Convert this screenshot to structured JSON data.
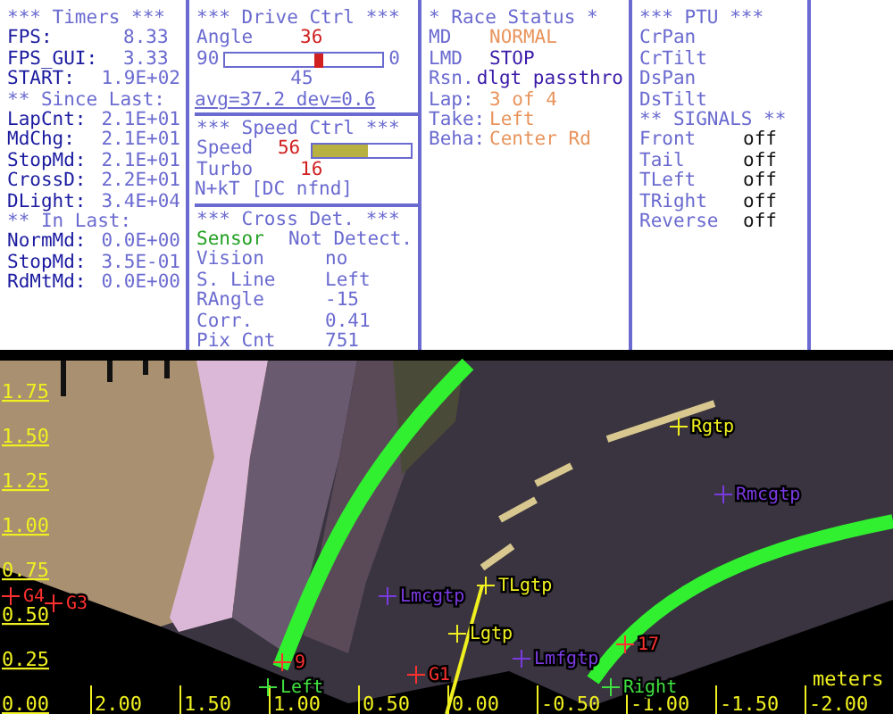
{
  "timers": {
    "title": "*** Timers ***",
    "rows": [
      {
        "kind": "row",
        "label": "FPS:",
        "value": "8.33"
      },
      {
        "kind": "row",
        "label": "FPS_GUI:",
        "value": "3.33"
      },
      {
        "kind": "row",
        "label": "START:",
        "value": "1.9E+02"
      },
      {
        "kind": "heading",
        "label": "** Since Last:"
      },
      {
        "kind": "row",
        "label": "LapCnt:",
        "value": "2.1E+01"
      },
      {
        "kind": "row",
        "label": "MdChg:",
        "value": "2.1E+01"
      },
      {
        "kind": "row",
        "label": "StopMd:",
        "value": "2.1E+01"
      },
      {
        "kind": "row",
        "label": "CrossD:",
        "value": "2.2E+01"
      },
      {
        "kind": "row",
        "label": "DLight:",
        "value": "3.4E+04"
      },
      {
        "kind": "heading",
        "label": "** In Last:"
      },
      {
        "kind": "row",
        "label": "NormMd:",
        "value": "0.0E+00"
      },
      {
        "kind": "row",
        "label": "StopMd:",
        "value": "3.5E-01"
      },
      {
        "kind": "row",
        "label": "RdMtMd:",
        "value": "0.0E+00"
      }
    ]
  },
  "drive_ctrl": {
    "title": "***  Drive Ctrl  ***",
    "angle_label": "Angle",
    "angle_value": "36",
    "slider": {
      "left_label": "90",
      "right_label": "0",
      "mid_label": "45",
      "level": 0.6
    },
    "stats": "avg=37.2  dev=0.6"
  },
  "speed_ctrl": {
    "title": "***  Speed Ctrl  ***",
    "speed_label": "Speed",
    "speed_value": "56",
    "speed_bar": {
      "level": 0.57
    },
    "turbo_label": "Turbo",
    "turbo_value": "16",
    "note": "N+kT [DC nfnd]"
  },
  "cross_det": {
    "title": "*** Cross Det. ***",
    "rows": [
      {
        "label": "Sensor",
        "value": "Not Detect.",
        "color": "#22a022"
      },
      {
        "label": "Vision",
        "value": "no",
        "color": "#6a6ad0"
      },
      {
        "label": "S. Line",
        "value": "Left",
        "color": "#6a6ad0"
      },
      {
        "label": "RAngle",
        "value": "-15",
        "color": "#6a6ad0"
      },
      {
        "label": "Corr.",
        "value": "0.41",
        "color": "#6a6ad0"
      },
      {
        "label": "Pix Cnt",
        "value": "751",
        "color": "#6a6ad0"
      }
    ]
  },
  "race_status": {
    "title": "* Race Status *",
    "rows": [
      {
        "label": "MD",
        "value": "NORMAL",
        "color": "#e8945c"
      },
      {
        "label": "LMD",
        "value": "STOP",
        "color": "#3a1aa8"
      },
      {
        "label": "Rsn.",
        "value": "dlgt passthro",
        "color": "#3a1aa8"
      },
      {
        "label": "Lap:",
        "value": "3 of 4",
        "color": "#e8945c"
      },
      {
        "label": "Take:",
        "value": "Left",
        "color": "#e8945c"
      },
      {
        "label": "Beha:",
        "value": "Center Rd",
        "color": "#e8945c"
      }
    ]
  },
  "ptu": {
    "title": "*** PTU ***",
    "items": [
      "CrPan",
      "CrTilt",
      "DsPan",
      "DsTilt"
    ],
    "signals_title": "** SIGNALS **",
    "signals": [
      {
        "label": "Front",
        "value": "off"
      },
      {
        "label": "Tail",
        "value": "off"
      },
      {
        "label": "TLeft",
        "value": "off"
      },
      {
        "label": "TRight",
        "value": "off"
      },
      {
        "label": "Reverse",
        "value": "off"
      }
    ]
  },
  "camera": {
    "y_labels": [
      "1.75",
      "1.50",
      "1.25",
      "1.00",
      "0.75",
      "0.50",
      "0.25",
      "0.00"
    ],
    "x_labels": [
      "2.00",
      "1.50",
      "1.00",
      "0.50",
      "0.00",
      "-0.50",
      "-1.00",
      "-1.50",
      "-2.00"
    ],
    "unit": "meters",
    "markers": [
      {
        "label": "G4",
        "color": "#ff3030"
      },
      {
        "label": "G3",
        "color": "#ff3030"
      },
      {
        "label": "9",
        "color": "#ff3030"
      },
      {
        "label": "Left",
        "color": "#40e040"
      },
      {
        "label": "G1",
        "color": "#ff3030"
      },
      {
        "label": "Lmcgtp",
        "color": "#7a3ae0"
      },
      {
        "label": "TLgtp",
        "color": "#f0f020"
      },
      {
        "label": "Lgtp",
        "color": "#f0f020"
      },
      {
        "label": "Lmfgtp",
        "color": "#7a3ae0"
      },
      {
        "label": "17",
        "color": "#ff3030"
      },
      {
        "label": "Right",
        "color": "#40e040"
      },
      {
        "label": "Rgtp",
        "color": "#f0f020"
      },
      {
        "label": "Rmcgtp",
        "color": "#7a3ae0"
      }
    ]
  }
}
